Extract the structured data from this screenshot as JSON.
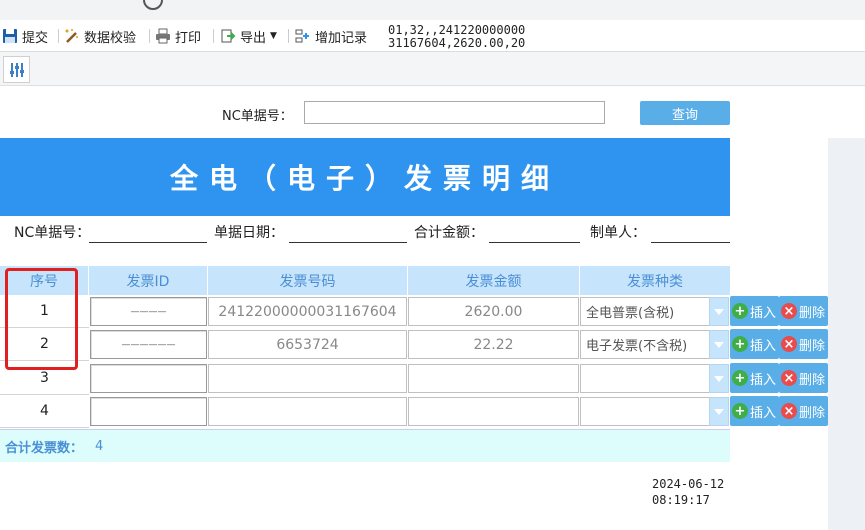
{
  "toolbar": {
    "submit": "提交",
    "validate": "数据校验",
    "print": "打印",
    "export": "导出",
    "add_record": "增加记录",
    "note_line1": "01,32,,241220000000",
    "note_line2": "31167604,2620.00,20"
  },
  "query": {
    "label": "NC单据号：",
    "value": "",
    "button": "查询"
  },
  "report": {
    "title": "全电（电子）发票明细",
    "fields": {
      "nc_no": "NC单据号：",
      "date": "单据日期：",
      "total_amount": "合计金额：",
      "creator": "制单人："
    }
  },
  "table": {
    "headers": [
      "序号",
      "发票ID",
      "发票号码",
      "发票金额",
      "发票种类"
    ],
    "rows": [
      {
        "seq": "1",
        "id": "————",
        "number": "24122000000031167604",
        "amount": "2620.00",
        "type": "全电普票(含税)"
      },
      {
        "seq": "2",
        "id": "——————",
        "number": "6653724",
        "amount": "22.22",
        "type": "电子发票(不含税)"
      },
      {
        "seq": "3",
        "id": "",
        "number": "",
        "amount": "",
        "type": ""
      },
      {
        "seq": "4",
        "id": "",
        "number": "",
        "amount": "",
        "type": ""
      }
    ],
    "insert_label": "插入",
    "delete_label": "删除",
    "total_label": "合计发票数：",
    "total_count": "4"
  },
  "footer": {
    "date": "2024-06-12",
    "time": "08:19:17"
  },
  "colors": {
    "title_bg": "#2f94f0",
    "header_bg": "#c6e4fb",
    "button_bg": "#5aaee8",
    "total_bg": "#ddfdfd",
    "highlight": "#e02020"
  }
}
